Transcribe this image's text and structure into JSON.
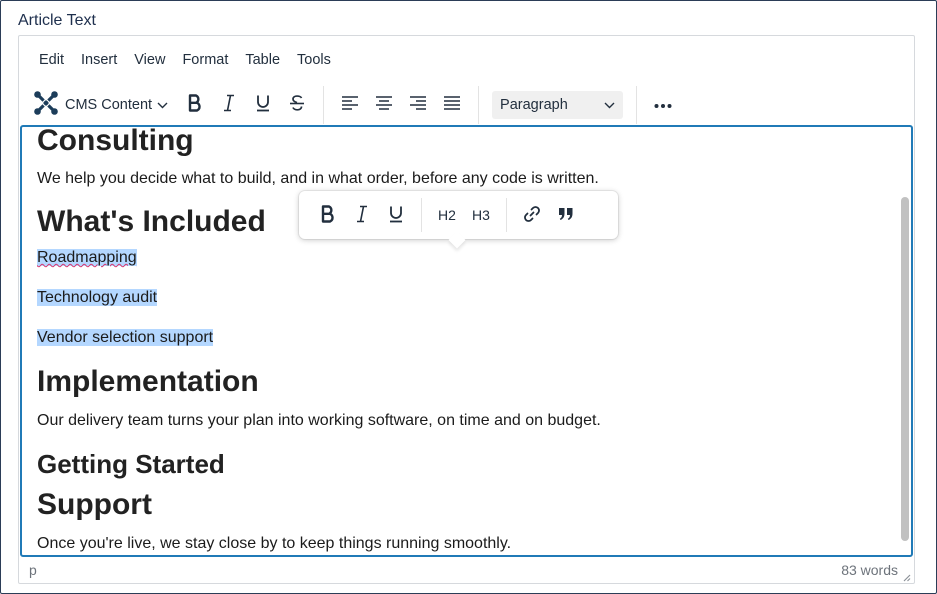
{
  "field_label": "Article Text",
  "menubar": [
    "Edit",
    "Insert",
    "View",
    "Format",
    "Table",
    "Tools"
  ],
  "toolbar": {
    "cms_label": "CMS Content",
    "block_format": "Paragraph"
  },
  "quickbar": {
    "h2_label": "H2",
    "h3_label": "H3"
  },
  "content": {
    "h1_consulting": "Consulting",
    "p_consulting": "We help you decide what to build, and in what order, before any code is written.",
    "h1_included": "What's Included",
    "item_1": "Roadmapping",
    "item_2": "Technology audit",
    "item_3": "Vendor selection support",
    "h1_implementation": "Implementation",
    "p_implementation": "Our delivery team turns your plan into working software, on time and on budget.",
    "h2_getting_started": "Getting Started",
    "h1_support": "Support",
    "p_support": "Once you're live, we stay close by to keep things running smoothly."
  },
  "statusbar": {
    "path": "p",
    "word_count": "83 words"
  },
  "colors": {
    "focus_border": "#207ab7",
    "selection": "#b4d7ff",
    "scroll_thumb": "#c1c1c1"
  }
}
